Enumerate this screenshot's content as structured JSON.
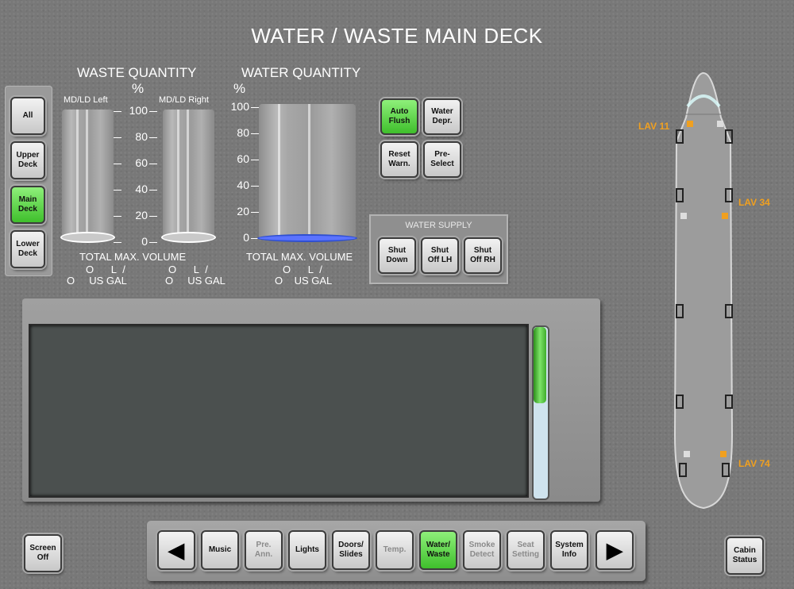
{
  "title": "WATER / WASTE MAIN DECK",
  "waste": {
    "header": "WASTE QUANTITY",
    "unit": "%",
    "left_label": "MD/LD Left",
    "right_label": "MD/LD Right",
    "ticks": [
      "100",
      "80",
      "60",
      "40",
      "20",
      "0"
    ],
    "total_label": "TOTAL MAX. VOLUME",
    "vol_l": "O",
    "vol_l_unit": "L",
    "slash": "/",
    "vol_gal": "O",
    "vol_gal_unit": "US GAL",
    "left_level_percent": 0,
    "right_level_percent": 0
  },
  "water": {
    "header": "WATER QUANTITY",
    "unit": "%",
    "ticks": [
      "100",
      "80",
      "60",
      "40",
      "20",
      "0"
    ],
    "total_label": "TOTAL MAX. VOLUME",
    "vol_l": "O",
    "vol_l_unit": "L",
    "slash": "/",
    "vol_gal": "O",
    "vol_gal_unit": "US GAL",
    "level_percent": 0
  },
  "deck_buttons": {
    "all": "All",
    "upper_1": "Upper",
    "upper_2": "Deck",
    "main_1": "Main",
    "main_2": "Deck",
    "lower_1": "Lower",
    "lower_2": "Deck",
    "active": "Main Deck"
  },
  "control_buttons": {
    "auto_flush_1": "Auto",
    "auto_flush_2": "Flush",
    "water_depr_1": "Water",
    "water_depr_2": "Depr.",
    "reset_warn_1": "Reset",
    "reset_warn_2": "Warn.",
    "preselect_1": "Pre-",
    "preselect_2": "Select"
  },
  "water_supply": {
    "label": "WATER SUPPLY",
    "shutdown_1": "Shut",
    "shutdown_2": "Down",
    "shutoff_lh_1": "Shut",
    "shutoff_lh_2": "Off LH",
    "shutoff_rh_1": "Shut",
    "shutoff_rh_2": "Off RH"
  },
  "aircraft": {
    "lav_11": "LAV 11",
    "lav_34": "LAV 34",
    "lav_74": "LAV 74",
    "lav_color": "#f0a020"
  },
  "nav": {
    "prev_icon": "left-arrow-icon",
    "music": "Music",
    "pre_ann_1": "Pre.",
    "pre_ann_2": "Ann.",
    "lights": "Lights",
    "doors_1": "Doors/",
    "doors_2": "Slides",
    "temp": "Temp.",
    "water_1": "Water/",
    "water_2": "Waste",
    "smoke_1": "Smoke",
    "smoke_2": "Detect",
    "seat_1": "Seat",
    "seat_2": "Setting",
    "system_1": "System",
    "system_2": "Info",
    "next_icon": "right-arrow-icon",
    "active": "Water/Waste"
  },
  "screen_off_1": "Screen",
  "screen_off_2": "Off",
  "cabin_status_1": "Cabin",
  "cabin_status_2": "Status",
  "colors": {
    "active_green": "#4fd13a",
    "lav_orange": "#f0a020",
    "water_blue": "#3050d0"
  }
}
